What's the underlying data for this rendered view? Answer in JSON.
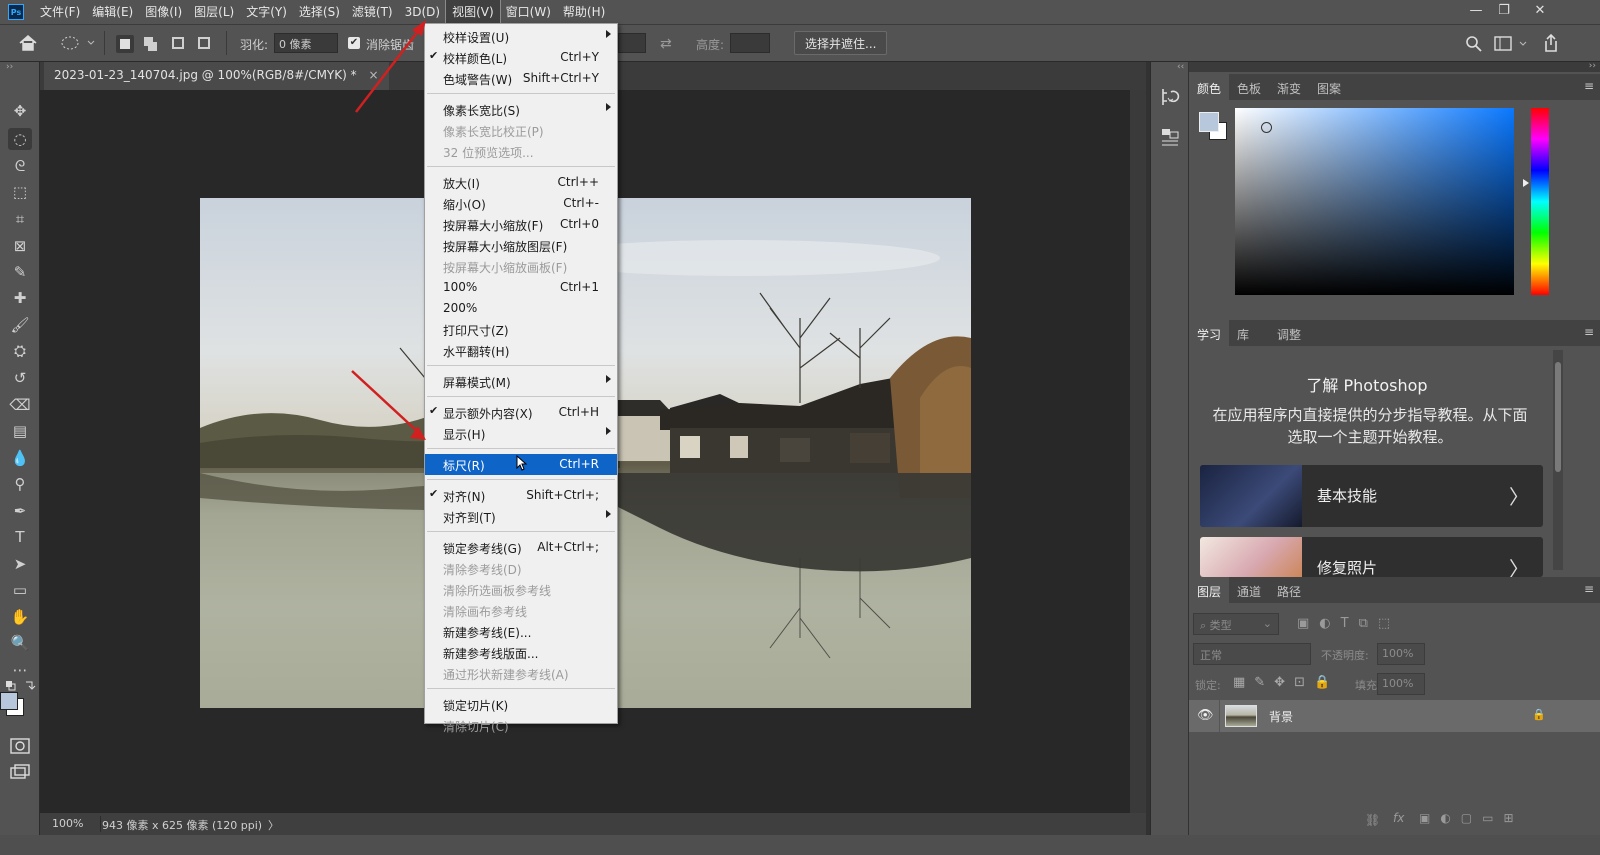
{
  "menubar": {
    "logo": "Ps",
    "items": [
      "文件(F)",
      "编辑(E)",
      "图像(I)",
      "图层(L)",
      "文字(Y)",
      "选择(S)",
      "滤镜(T)",
      "3D(D)",
      "视图(V)",
      "窗口(W)",
      "帮助(H)"
    ],
    "active_index": 8,
    "window_controls": [
      "—",
      "❐",
      "✕"
    ]
  },
  "options_bar": {
    "feather_label": "羽化:",
    "feather_value": "0 像素",
    "antialias_label": "消除锯齿",
    "antialias_checked": true,
    "height_label": "高度:",
    "select_mask_button": "选择并遮住..."
  },
  "toolbar": {
    "tools": [
      "move-tool-icon",
      "elliptical-marquee-icon",
      "lasso-icon",
      "object-select-icon",
      "crop-icon",
      "frame-icon",
      "eyedropper-icon",
      "healing-brush-icon",
      "brush-icon",
      "stamp-icon",
      "history-brush-icon",
      "eraser-icon",
      "gradient-icon",
      "blur-icon",
      "dodge-icon",
      "pen-icon",
      "type-icon",
      "path-select-icon",
      "rectangle-icon",
      "hand-icon",
      "zoom-icon",
      "more-tools-icon"
    ]
  },
  "document": {
    "tab_title": "2023-01-23_140704.jpg @ 100%(RGB/8#/CMYK) *",
    "tab_close": "×"
  },
  "status": {
    "zoom": "100%",
    "info": "943 像素 x 625 像素 (120 ppi)",
    "arrow": "〉"
  },
  "view_menu": {
    "items": [
      {
        "label": "校样设置(U)",
        "shortcut": "",
        "submenu": true,
        "checked": false,
        "disabled": false
      },
      {
        "label": "校样颜色(L)",
        "shortcut": "Ctrl+Y",
        "submenu": false,
        "checked": true,
        "disabled": false
      },
      {
        "label": "色域警告(W)",
        "shortcut": "Shift+Ctrl+Y",
        "submenu": false,
        "checked": false,
        "disabled": false
      },
      {
        "sep": true
      },
      {
        "label": "像素长宽比(S)",
        "shortcut": "",
        "submenu": true,
        "checked": false,
        "disabled": false
      },
      {
        "label": "像素长宽比校正(P)",
        "shortcut": "",
        "submenu": false,
        "checked": false,
        "disabled": true
      },
      {
        "label": "32 位预览选项...",
        "shortcut": "",
        "submenu": false,
        "checked": false,
        "disabled": true
      },
      {
        "sep": true
      },
      {
        "label": "放大(I)",
        "shortcut": "Ctrl++",
        "submenu": false,
        "checked": false,
        "disabled": false
      },
      {
        "label": "缩小(O)",
        "shortcut": "Ctrl+-",
        "submenu": false,
        "checked": false,
        "disabled": false
      },
      {
        "label": "按屏幕大小缩放(F)",
        "shortcut": "Ctrl+0",
        "submenu": false,
        "checked": false,
        "disabled": false
      },
      {
        "label": "按屏幕大小缩放图层(F)",
        "shortcut": "",
        "submenu": false,
        "checked": false,
        "disabled": false
      },
      {
        "label": "按屏幕大小缩放画板(F)",
        "shortcut": "",
        "submenu": false,
        "checked": false,
        "disabled": true
      },
      {
        "label": "100%",
        "shortcut": "Ctrl+1",
        "submenu": false,
        "checked": false,
        "disabled": false
      },
      {
        "label": "200%",
        "shortcut": "",
        "submenu": false,
        "checked": false,
        "disabled": false
      },
      {
        "label": "打印尺寸(Z)",
        "shortcut": "",
        "submenu": false,
        "checked": false,
        "disabled": false
      },
      {
        "label": "水平翻转(H)",
        "shortcut": "",
        "submenu": false,
        "checked": false,
        "disabled": false
      },
      {
        "sep": true
      },
      {
        "label": "屏幕模式(M)",
        "shortcut": "",
        "submenu": true,
        "checked": false,
        "disabled": false
      },
      {
        "sep": true
      },
      {
        "label": "显示额外内容(X)",
        "shortcut": "Ctrl+H",
        "submenu": false,
        "checked": true,
        "disabled": false
      },
      {
        "label": "显示(H)",
        "shortcut": "",
        "submenu": true,
        "checked": false,
        "disabled": false
      },
      {
        "sep": true
      },
      {
        "label": "标尺(R)",
        "shortcut": "Ctrl+R",
        "submenu": false,
        "checked": false,
        "disabled": false,
        "highlighted": true
      },
      {
        "sep": true
      },
      {
        "label": "对齐(N)",
        "shortcut": "Shift+Ctrl+;",
        "submenu": false,
        "checked": true,
        "disabled": false
      },
      {
        "label": "对齐到(T)",
        "shortcut": "",
        "submenu": true,
        "checked": false,
        "disabled": false
      },
      {
        "sep": true
      },
      {
        "label": "锁定参考线(G)",
        "shortcut": "Alt+Ctrl+;",
        "submenu": false,
        "checked": false,
        "disabled": false
      },
      {
        "label": "清除参考线(D)",
        "shortcut": "",
        "submenu": false,
        "checked": false,
        "disabled": true
      },
      {
        "label": "清除所选画板参考线",
        "shortcut": "",
        "submenu": false,
        "checked": false,
        "disabled": true
      },
      {
        "label": "清除画布参考线",
        "shortcut": "",
        "submenu": false,
        "checked": false,
        "disabled": true
      },
      {
        "label": "新建参考线(E)...",
        "shortcut": "",
        "submenu": false,
        "checked": false,
        "disabled": false
      },
      {
        "label": "新建参考线版面...",
        "shortcut": "",
        "submenu": false,
        "checked": false,
        "disabled": false
      },
      {
        "label": "通过形状新建参考线(A)",
        "shortcut": "",
        "submenu": false,
        "checked": false,
        "disabled": true
      },
      {
        "sep": true
      },
      {
        "label": "锁定切片(K)",
        "shortcut": "",
        "submenu": false,
        "checked": false,
        "disabled": false
      },
      {
        "label": "清除切片(C)",
        "shortcut": "",
        "submenu": false,
        "checked": false,
        "disabled": true
      }
    ]
  },
  "color_panel": {
    "tabs": [
      "颜色",
      "色板",
      "渐变",
      "图案"
    ],
    "foreground": "#b8c8dc",
    "background": "#ffffff"
  },
  "learn_panel": {
    "tabs": [
      "学习",
      "库",
      "调整"
    ],
    "title": "了解 Photoshop",
    "description": "在应用程序内直接提供的分步指导教程。从下面选取一个主题开始教程。",
    "cards": [
      {
        "title": "基本技能",
        "chevron": "〉"
      },
      {
        "title": "修复照片",
        "chevron": "〉"
      }
    ]
  },
  "layers_panel": {
    "tabs": [
      "图层",
      "通道",
      "路径"
    ],
    "filter_placeholder": "类型",
    "blend_mode": "正常",
    "opacity_label": "不透明度:",
    "opacity_value": "100%",
    "lock_label": "锁定:",
    "fill_label": "填充:",
    "fill_value": "100%",
    "layers": [
      {
        "name": "背景",
        "visible": true,
        "locked": true
      }
    ],
    "footer_icons": [
      "link-icon",
      "fx-icon"
    ]
  }
}
